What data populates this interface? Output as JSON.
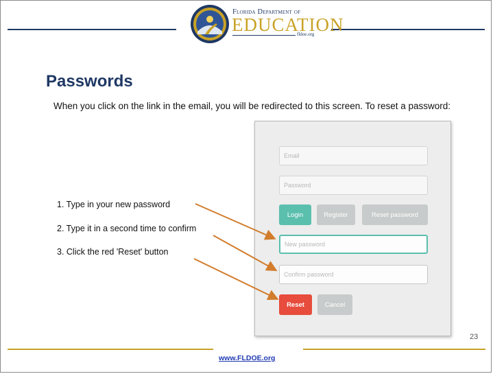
{
  "header": {
    "logo_top": "Florida Department of",
    "logo_main": "EDUCATION",
    "logo_sub": "fldoe.org"
  },
  "slide": {
    "title": "Passwords",
    "instruction": "When you click on the link in the email, you will be redirected to this screen. To reset a password:",
    "steps": [
      "1. Type in your new password",
      "2. Type it in a second time to confirm",
      "3. Click the red 'Reset' button"
    ],
    "page_number": "23"
  },
  "form": {
    "email_placeholder": "Email",
    "password_placeholder": "Password",
    "login_label": "Login",
    "register_label": "Register",
    "reset_password_label": "Reset password",
    "new_password_placeholder": "New password",
    "confirm_password_placeholder": "Confirm password",
    "reset_label": "Reset",
    "cancel_label": "Cancel"
  },
  "footer": {
    "link": "www.FLDOE.org"
  },
  "colors": {
    "navy": "#1f3864",
    "gold": "#c9a227",
    "teal": "#5bbfae",
    "red": "#e74c3c",
    "arrow": "#d27c2c",
    "gray_button": "#c8cbcb"
  }
}
